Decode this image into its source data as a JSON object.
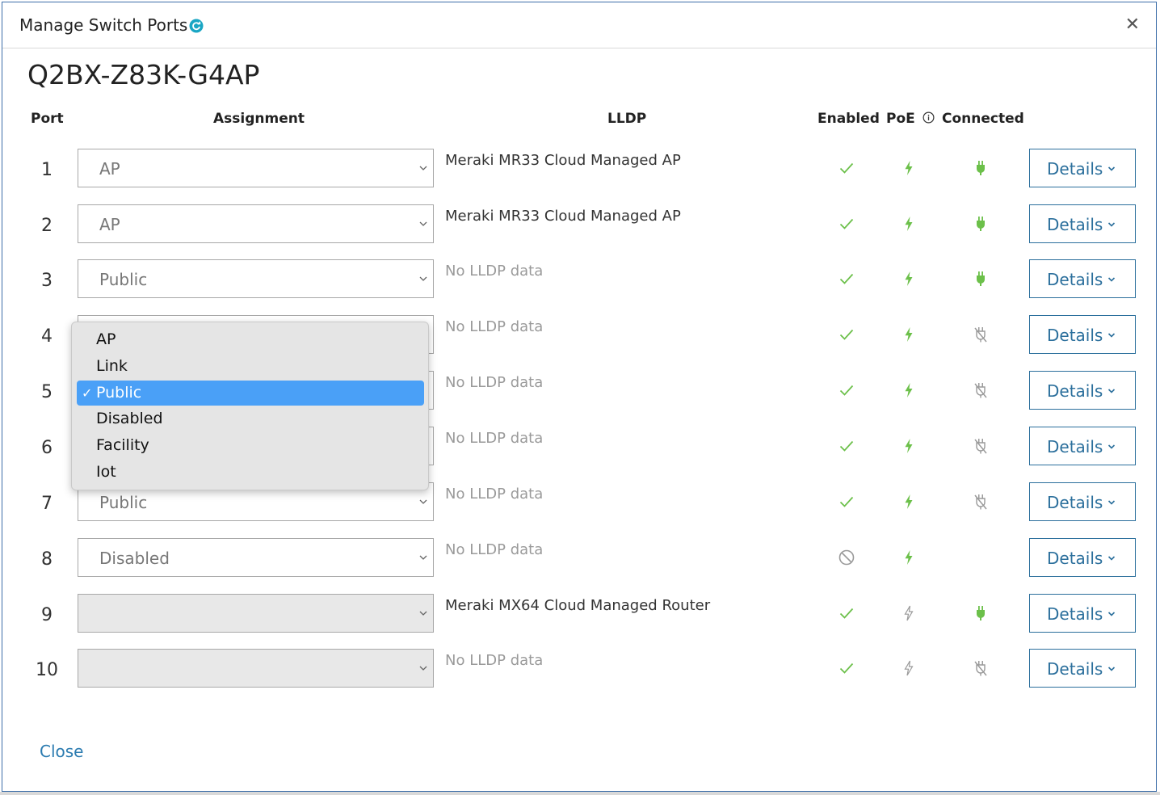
{
  "dialog": {
    "title": "Manage Switch Ports",
    "device_name": "Q2BX-Z83K-G4AP",
    "close_link": "Close"
  },
  "columns": {
    "port": "Port",
    "assignment": "Assignment",
    "lldp": "LLDP",
    "enabled": "Enabled",
    "poe": "PoE",
    "connected": "Connected"
  },
  "details_label": "Details",
  "ports": [
    {
      "port": "1",
      "assignment": "AP",
      "lldp": "Meraki MR33 Cloud Managed AP",
      "enabled": "check",
      "poe": "on",
      "connected": "plug"
    },
    {
      "port": "2",
      "assignment": "AP",
      "lldp": "Meraki MR33 Cloud Managed AP",
      "enabled": "check",
      "poe": "on",
      "connected": "plug"
    },
    {
      "port": "3",
      "assignment": "Public",
      "lldp": "No LLDP data",
      "enabled": "check",
      "poe": "on",
      "connected": "plug"
    },
    {
      "port": "4",
      "assignment": "",
      "lldp": "No LLDP data",
      "enabled": "check",
      "poe": "on",
      "connected": "unplugged"
    },
    {
      "port": "5",
      "assignment": "",
      "lldp": "No LLDP data",
      "enabled": "check",
      "poe": "on",
      "connected": "unplugged"
    },
    {
      "port": "6",
      "assignment": "",
      "lldp": "No LLDP data",
      "enabled": "check",
      "poe": "on",
      "connected": "unplugged"
    },
    {
      "port": "7",
      "assignment": "Public",
      "lldp": "No LLDP data",
      "enabled": "check",
      "poe": "on",
      "connected": "unplugged"
    },
    {
      "port": "8",
      "assignment": "Disabled",
      "lldp": "No LLDP data",
      "enabled": "blocked",
      "poe": "on",
      "connected": "none"
    },
    {
      "port": "9",
      "assignment": "",
      "lldp": "Meraki MX64 Cloud Managed Router",
      "enabled": "check",
      "poe": "off",
      "connected": "plug"
    },
    {
      "port": "10",
      "assignment": "",
      "lldp": "No LLDP data",
      "enabled": "check",
      "poe": "off",
      "connected": "unplugged"
    }
  ],
  "dropdown": {
    "options": [
      "AP",
      "Link",
      "Public",
      "Disabled",
      "Facility",
      "Iot"
    ],
    "selected": "Public",
    "check_glyph": "✓"
  },
  "colors": {
    "accent": "#2b6f9c",
    "link": "#2b7bb0",
    "status_green": "#6cc04a",
    "icon_gray": "#9a9a9a",
    "dropdown_selected": "#4aa0f7"
  }
}
